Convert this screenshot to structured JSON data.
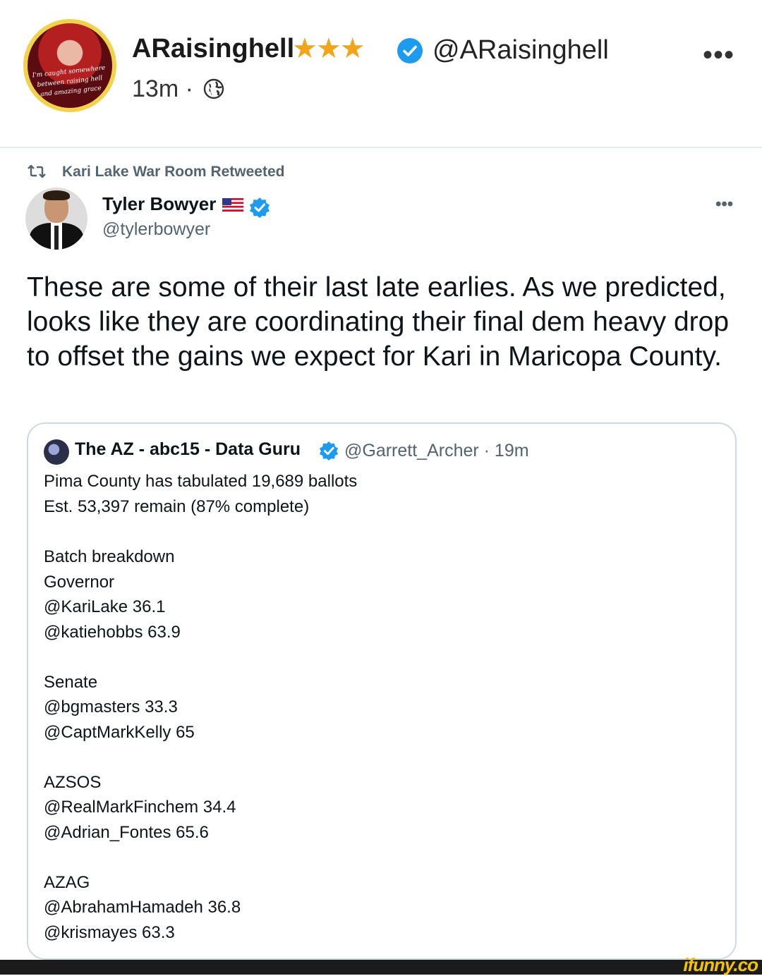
{
  "post": {
    "author_name": "ARaisinghell",
    "stars": "★★★",
    "author_handle": "@ARaisinghell",
    "time": "13m ·",
    "more": "•••",
    "avatar_script": "I'm caught somewhere between raising hell and amazing grace"
  },
  "tweet": {
    "retweeted_by": "Kari Lake War Room Retweeted",
    "name": "Tyler Bowyer",
    "handle": "@tylerbowyer",
    "more": "•••",
    "text": "These are some of their last late earlies. As we predicted, looks like they are coordinating their final dem heavy drop to offset the gains we expect for Kari in Maricopa County."
  },
  "quote": {
    "name": "The AZ - abc15 - Data Guru",
    "handle_time": "@Garrett_Archer · 19m",
    "lines": [
      "Pima County has tabulated 19,689 ballots",
      "Est. 53,397 remain (87% complete)",
      "Batch breakdown",
      "Governor",
      "@KariLake 36.1",
      "@katiehobbs 63.9",
      "Senate",
      "@bgmasters 33.3",
      "@CaptMarkKelly 65",
      "AZSOS",
      "@RealMarkFinchem 34.4",
      "@Adrian_Fontes 65.6",
      "AZAG",
      "@AbrahamHamadeh 36.8",
      "@krismayes 63.3"
    ]
  },
  "watermark": "ifunny.co",
  "colors": {
    "verified": "#1d9bf0",
    "stars": "#f2a51a",
    "muted": "#536471",
    "watermark": "#f5c200"
  }
}
